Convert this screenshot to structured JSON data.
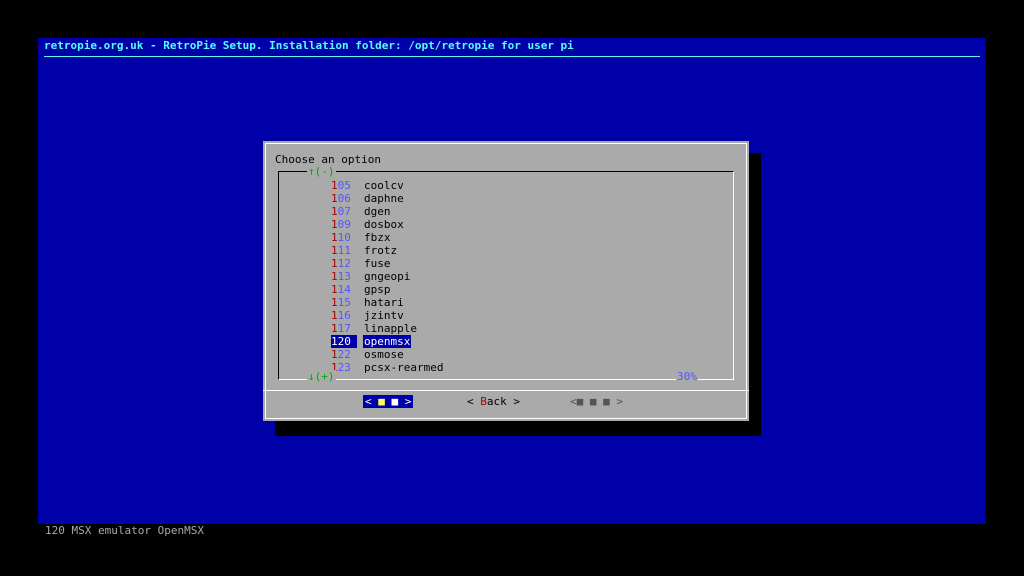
{
  "header": {
    "title": "retropie.org.uk - RetroPie Setup. Installation folder: /opt/retropie for user pi"
  },
  "dialog": {
    "title": "Choose an option",
    "scroll_top": "↑(-)",
    "scroll_bottom": "↓(+)",
    "scroll_percent": "30%",
    "items": [
      {
        "tag_hot": "1",
        "tag_rest": "05",
        "label": "coolcv"
      },
      {
        "tag_hot": "1",
        "tag_rest": "06",
        "label": "daphne"
      },
      {
        "tag_hot": "1",
        "tag_rest": "07",
        "label": "dgen"
      },
      {
        "tag_hot": "1",
        "tag_rest": "09",
        "label": "dosbox"
      },
      {
        "tag_hot": "1",
        "tag_rest": "10",
        "label": "fbzx"
      },
      {
        "tag_hot": "1",
        "tag_rest": "11",
        "label": "frotz"
      },
      {
        "tag_hot": "1",
        "tag_rest": "12",
        "label": "fuse"
      },
      {
        "tag_hot": "1",
        "tag_rest": "13",
        "label": "gngeopi"
      },
      {
        "tag_hot": "1",
        "tag_rest": "14",
        "label": "gpsp"
      },
      {
        "tag_hot": "1",
        "tag_rest": "15",
        "label": "hatari"
      },
      {
        "tag_hot": "1",
        "tag_rest": "16",
        "label": "jzintv"
      },
      {
        "tag_hot": "1",
        "tag_rest": "17",
        "label": "linapple"
      },
      {
        "tag_hot": "1",
        "tag_rest": "20",
        "label": "openmsx",
        "selected": true
      },
      {
        "tag_hot": "1",
        "tag_rest": "22",
        "label": "osmose"
      },
      {
        "tag_hot": "1",
        "tag_rest": "23",
        "label": "pcsx-rearmed"
      }
    ],
    "buttons": {
      "ok": {
        "left": "< ",
        "hot": "■",
        "rest": " ■",
        "right": " >"
      },
      "back": {
        "left": "< ",
        "hot": "B",
        "rest": "ack",
        "right": " >"
      },
      "extra": {
        "label": "<■ ■ ■ >"
      }
    }
  },
  "status": {
    "text": "120 MSX emulator OpenMSX"
  }
}
